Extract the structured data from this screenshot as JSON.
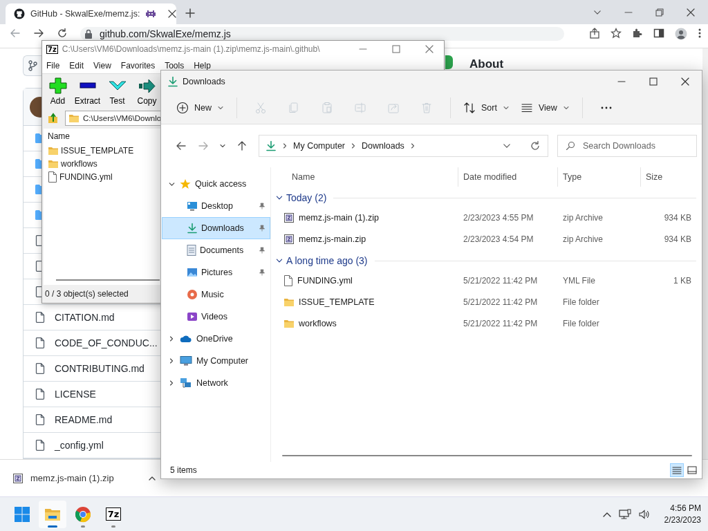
{
  "browser": {
    "tab": {
      "title": "GitHub - SkwalExe/memz.js:"
    },
    "address": "github.com/SkwalExe/memz.js",
    "repo_files": [
      {
        "kind": "folder"
      },
      {
        "kind": "folder"
      },
      {
        "kind": "folder"
      },
      {
        "kind": "folder"
      },
      {
        "kind": "file"
      },
      {
        "kind": "file"
      },
      {
        "kind": "file"
      },
      {
        "kind": "file",
        "name": "CITATION.md"
      },
      {
        "kind": "file",
        "name": "CODE_OF_CONDUC..."
      },
      {
        "kind": "file",
        "name": "CONTRIBUTING.md"
      },
      {
        "kind": "file",
        "name": "LICENSE"
      },
      {
        "kind": "file",
        "name": "README.md"
      },
      {
        "kind": "file",
        "name": "_config.yml"
      }
    ],
    "about": "About",
    "downloads": [
      {
        "name": "memz.js-main (1).zip"
      }
    ]
  },
  "sevenzip": {
    "logo": "7z",
    "title": "C:\\Users\\VM6\\Downloads\\memz.js-main (1).zip\\memz.js-main\\.github\\",
    "menu": [
      "File",
      "Edit",
      "View",
      "Favorites",
      "Tools",
      "Help"
    ],
    "toolbar": [
      {
        "kind": "add",
        "label": "Add"
      },
      {
        "kind": "extract",
        "label": "Extract"
      },
      {
        "kind": "test",
        "label": "Test"
      },
      {
        "kind": "copy",
        "label": "Copy"
      }
    ],
    "path": "C:\\Users\\VM6\\Downlo",
    "columns": [
      "Name"
    ],
    "files": [
      {
        "kind": "folder",
        "name": "ISSUE_TEMPLATE"
      },
      {
        "kind": "folder",
        "name": "workflows"
      },
      {
        "kind": "file",
        "name": "FUNDING.yml"
      }
    ],
    "status": "0 / 3 object(s) selected"
  },
  "explorer": {
    "title": "Downloads",
    "commands": [
      {
        "kind": "new",
        "label": "New",
        "disabled": false
      },
      {
        "kind": "cut",
        "disabled": true
      },
      {
        "kind": "copy",
        "disabled": true
      },
      {
        "kind": "paste",
        "disabled": true
      },
      {
        "kind": "rename",
        "disabled": true
      },
      {
        "kind": "share",
        "disabled": true
      },
      {
        "kind": "delete",
        "disabled": true
      },
      {
        "kind": "sort",
        "label": "Sort",
        "disabled": false
      },
      {
        "kind": "view",
        "label": "View",
        "disabled": false
      },
      {
        "kind": "more",
        "disabled": false
      }
    ],
    "breadcrumb": [
      "My Computer",
      "Downloads"
    ],
    "search": {
      "placeholder": "Search Downloads"
    },
    "nav": [
      {
        "label": "Quick access",
        "kind": "star",
        "expanded": true,
        "selected": false,
        "children": [
          {
            "label": "Desktop",
            "kind": "desktop",
            "pinned": true,
            "selected": false
          },
          {
            "label": "Downloads",
            "kind": "download",
            "pinned": true,
            "selected": true
          },
          {
            "label": "Documents",
            "kind": "document",
            "pinned": true,
            "selected": false
          },
          {
            "label": "Pictures",
            "kind": "picture",
            "pinned": true,
            "selected": false
          },
          {
            "label": "Music",
            "kind": "music",
            "pinned": false,
            "selected": false
          },
          {
            "label": "Videos",
            "kind": "video",
            "pinned": false,
            "selected": false
          }
        ]
      },
      {
        "label": "OneDrive",
        "kind": "cloud",
        "expanded": false,
        "selected": false
      },
      {
        "label": "My Computer",
        "kind": "computer",
        "expanded": false,
        "selected": false
      },
      {
        "label": "Network",
        "kind": "network",
        "expanded": false,
        "selected": false
      }
    ],
    "columns": [
      "Name",
      "Date modified",
      "Type",
      "Size"
    ],
    "groups": [
      {
        "label": "Today (2)",
        "expanded": true,
        "files": [
          {
            "kind": "zip",
            "name": "memz.js-main (1).zip",
            "date": "2/23/2023 4:55 PM",
            "type": "zip Archive",
            "size": "934 KB"
          },
          {
            "kind": "zip",
            "name": "memz.js-main.zip",
            "date": "2/23/2023 4:54 PM",
            "type": "zip Archive",
            "size": "934 KB"
          }
        ]
      },
      {
        "label": "A long time ago (3)",
        "expanded": true,
        "files": [
          {
            "kind": "file",
            "name": "FUNDING.yml",
            "date": "5/21/2022 11:42 PM",
            "type": "YML File",
            "size": "1 KB"
          },
          {
            "kind": "folder",
            "name": "ISSUE_TEMPLATE",
            "date": "5/21/2022 11:42 PM",
            "type": "File folder"
          },
          {
            "kind": "folder",
            "name": "workflows",
            "date": "5/21/2022 11:42 PM",
            "type": "File folder"
          }
        ]
      }
    ],
    "status": "5 items",
    "view_buttons": [
      {
        "kind": "details",
        "selected": true
      },
      {
        "kind": "tiles",
        "selected": false
      }
    ]
  },
  "taskbar": {
    "apps": [
      {
        "kind": "start",
        "running": false,
        "active": false
      },
      {
        "kind": "explorer",
        "running": true,
        "active": true
      },
      {
        "kind": "browser",
        "running": true,
        "active": false
      },
      {
        "kind": "sevenzip",
        "label": "7z",
        "running": true,
        "active": false
      }
    ],
    "time": "4:56 PM",
    "date": "2/23/2023"
  }
}
